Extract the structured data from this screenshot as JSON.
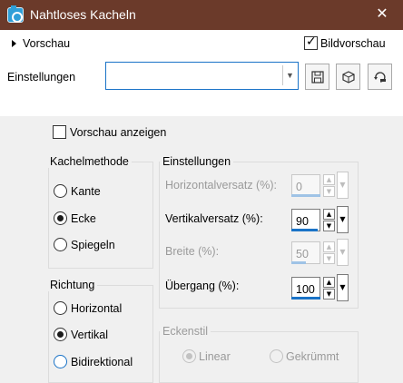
{
  "window": {
    "title": "Nahtloses Kacheln",
    "close_glyph": "✕"
  },
  "top": {
    "preview_label": "Vorschau",
    "bildvorschau_label": "Bildvorschau",
    "bildvorschau_checked": true,
    "settings_label": "Einstellungen",
    "settings_value": "",
    "toolbar_icons": [
      "save-icon",
      "cube-icon",
      "reset-icon"
    ]
  },
  "preview_toggle": {
    "label": "Vorschau anzeigen",
    "checked": false
  },
  "tiling_method": {
    "title": "Kachelmethode",
    "options": [
      {
        "label": "Kante",
        "checked": false
      },
      {
        "label": "Ecke",
        "checked": true
      },
      {
        "label": "Spiegeln",
        "checked": false
      }
    ]
  },
  "direction": {
    "title": "Richtung",
    "options": [
      {
        "label": "Horizontal",
        "checked": false
      },
      {
        "label": "Vertikal",
        "checked": true
      },
      {
        "label": "Bidirektional",
        "checked": false
      }
    ]
  },
  "settings": {
    "title": "Einstellungen",
    "fields": [
      {
        "label": "Horizontalversatz (%):",
        "value": "0",
        "enabled": false
      },
      {
        "label": "Vertikalversatz (%):",
        "value": "90",
        "enabled": true
      },
      {
        "label": "Breite (%):",
        "value": "50",
        "enabled": false
      },
      {
        "label": "Übergang (%):",
        "value": "100",
        "enabled": true
      }
    ]
  },
  "corner_style": {
    "title": "Eckenstil",
    "options": [
      {
        "label": "Linear",
        "checked": true,
        "enabled": false
      },
      {
        "label": "Gekrümmt",
        "checked": false,
        "enabled": false
      }
    ]
  },
  "colors": {
    "titlebar": "#6b3a2a",
    "accent": "#1a73c7"
  }
}
